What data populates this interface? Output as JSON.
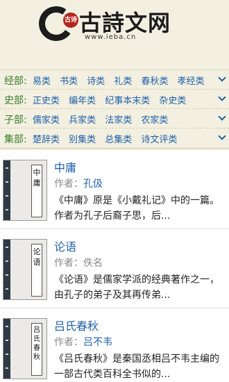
{
  "header": {
    "logo_seal": "古诗",
    "logo_text": "古詩文网",
    "logo_url": "www.ieba.cn"
  },
  "categories": [
    {
      "label": "经部:",
      "items": [
        "易类",
        "书类",
        "诗类",
        "礼类",
        "春秋类",
        "孝经类"
      ]
    },
    {
      "label": "史部:",
      "items": [
        "正史类",
        "编年类",
        "纪事本末类",
        "杂史类"
      ]
    },
    {
      "label": "子部:",
      "items": [
        "儒家类",
        "兵家类",
        "法家类",
        "农家类"
      ]
    },
    {
      "label": "集部:",
      "items": [
        "楚辞类",
        "别集类",
        "总集类",
        "诗文评类"
      ]
    }
  ],
  "books": [
    {
      "cover": "中庸",
      "title": "中庸",
      "author_label": "作者：",
      "author": "孔伋",
      "desc": "《中庸》原是《小戴礼记》中的一篇。作者为孔子后裔子思，后..."
    },
    {
      "cover": "论语",
      "title": "论语",
      "author_label": "作者：",
      "author": "佚名",
      "desc": "《论语》是儒家学派的经典著作之一，由孔子的弟子及其再传弟..."
    },
    {
      "cover": "吕氏春秋",
      "title": "吕氏春秋",
      "author_label": "作者：",
      "author": "吕不韦",
      "desc": "《吕氏春秋》是秦国丞相吕不韦主编的一部古代类百科全书似的..."
    }
  ]
}
